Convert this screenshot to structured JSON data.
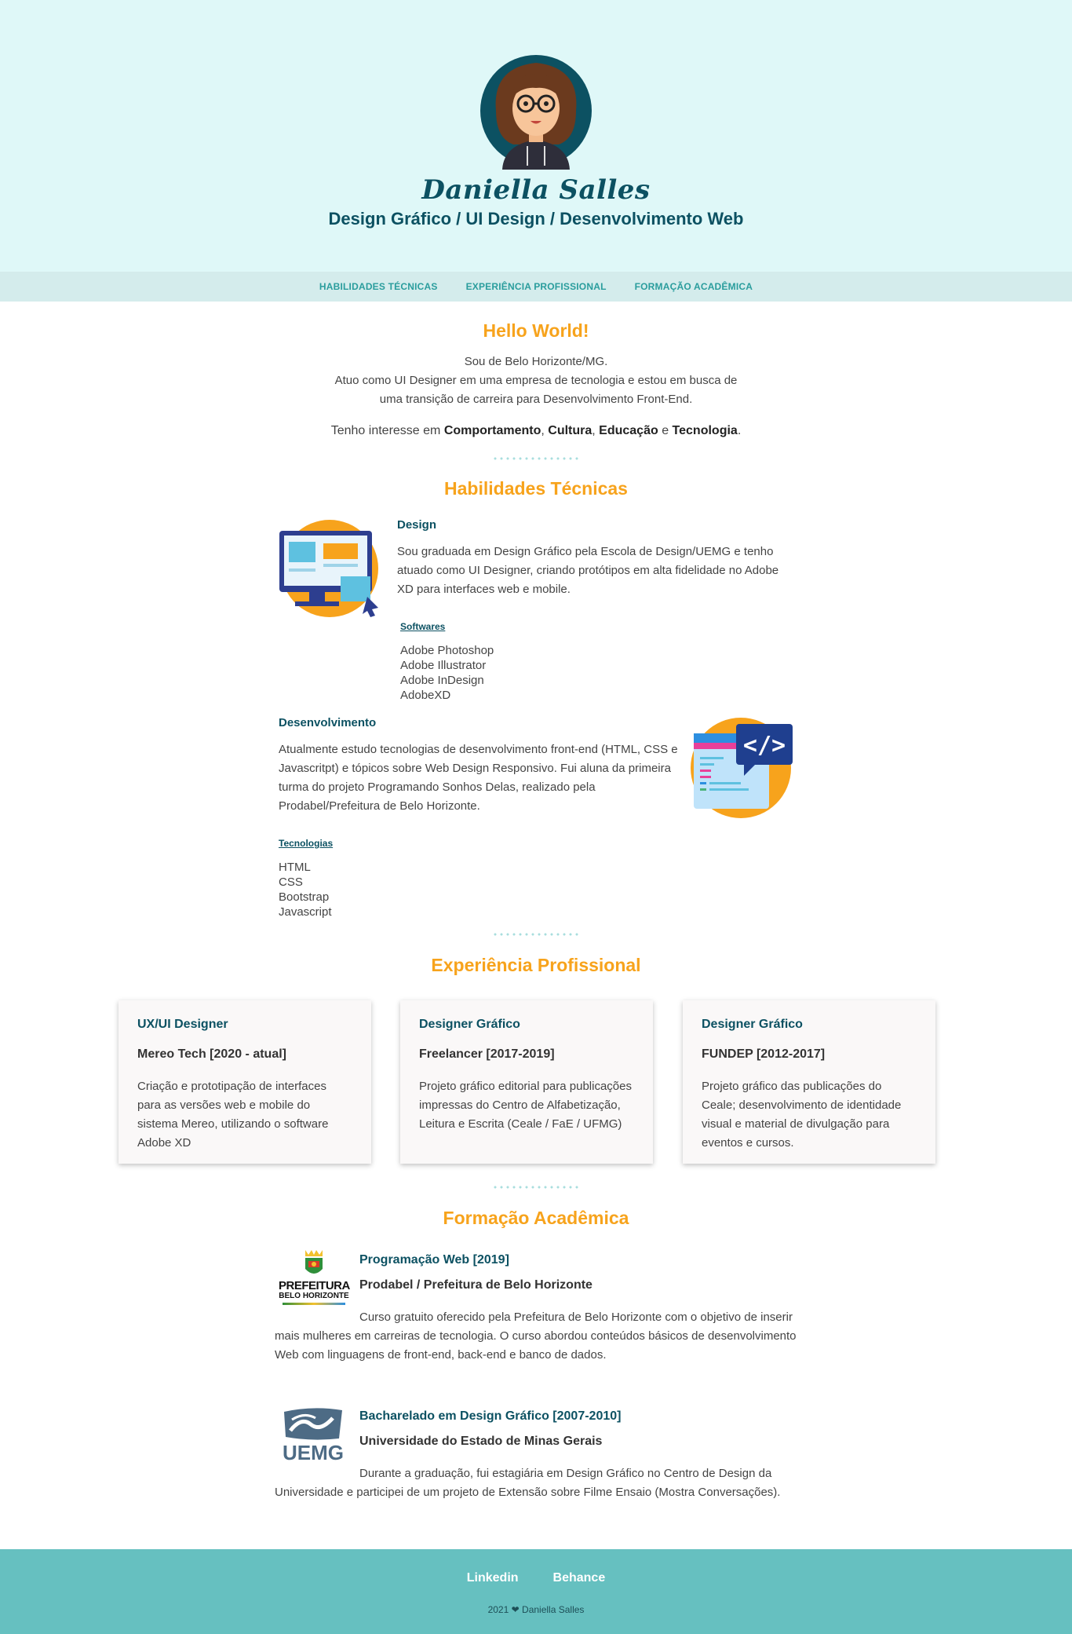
{
  "header": {
    "name": "Daniella Salles",
    "subtitle": "Design Gráfico / UI Design / Desenvolvimento Web"
  },
  "nav": [
    "HABILIDADES TÉCNICAS",
    "EXPERIÊNCIA PROFISSIONAL",
    "FORMAÇÃO ACADÊMICA"
  ],
  "intro": {
    "title": "Hello World!",
    "line1": "Sou de Belo Horizonte/MG.",
    "line2": "Atuo como UI Designer em uma empresa de tecnologia e estou em busca de",
    "line3": "uma transição de carreira para Desenvolvimento Front-End.",
    "interest_prefix": "Tenho interesse em ",
    "interests": [
      "Comportamento",
      "Cultura",
      "Educação",
      "Tecnologia"
    ],
    "sep1": ", ",
    "sep2": ", ",
    "sep3": " e ",
    "end": "."
  },
  "skills": {
    "title": "Habilidades Técnicas",
    "design": {
      "title": "Design",
      "text": "Sou graduada em Design Gráfico pela Escola de Design/UEMG e tenho atuado como UI Designer, criando protótipos em alta fidelidade no Adobe XD para interfaces web e mobile.",
      "list_title": "Softwares",
      "items": [
        "Adobe Photoshop",
        "Adobe Illustrator",
        "Adobe InDesign",
        "AdobeXD"
      ]
    },
    "dev": {
      "title": "Desenvolvimento",
      "text": "Atualmente estudo tecnologias de desenvolvimento front-end (HTML, CSS e Javascritpt) e tópicos sobre Web Design Responsivo. Fui aluna da primeira turma do projeto Programando Sonhos Delas, realizado pela Prodabel/Prefeitura de Belo Horizonte.",
      "list_title": "Tecnologias",
      "items": [
        "HTML",
        "CSS",
        "Bootstrap",
        "Javascript"
      ]
    }
  },
  "experience": {
    "title": "Experiência Profissional",
    "cards": [
      {
        "role": "UX/UI Designer",
        "company": "Mereo Tech [2020 - atual]",
        "desc": "Criação e prototipação de interfaces para as versões web e mobile do sistema Mereo, utilizando o software Adobe XD"
      },
      {
        "role": "Designer Gráfico",
        "company": "Freelancer [2017-2019]",
        "desc": "Projeto gráfico editorial para publicações impressas do Centro de Alfabetização, Leitura e Escrita (Ceale / FaE / UFMG)"
      },
      {
        "role": "Designer Gráfico",
        "company": "FUNDEP [2012-2017]",
        "desc": "Projeto gráfico das publicações do Ceale; desenvolvimento de identidade visual e material de divulgação para eventos e cursos."
      }
    ]
  },
  "education": {
    "title": "Formação Acadêmica",
    "items": [
      {
        "course": "Programação Web [2019]",
        "institution": "Prodabel / Prefeitura de Belo Horizonte",
        "desc": "Curso gratuito oferecido pela Prefeitura de Belo Horizonte com o objetivo de inserir mais mulheres em carreiras de tecnologia. O curso abordou conteúdos básicos de desenvolvimento Web com linguagens de front-end, back-end e banco de dados.",
        "logo_line1": "PREFEITURA",
        "logo_line2": "BELO HORIZONTE"
      },
      {
        "course": "Bacharelado em Design Gráfico [2007-2010]",
        "institution": "Universidade do Estado de Minas Gerais",
        "desc": "Durante a graduação, fui estagiária em Design Gráfico no Centro de Design da Universidade e participei de um projeto de Extensão sobre Filme Ensaio (Mostra Conversações).",
        "logo_text": "UEMG"
      }
    ]
  },
  "footer": {
    "links": [
      "Linkedin",
      "Behance"
    ],
    "year": "2021",
    "heart": "❤",
    "author": "Daniella Salles"
  },
  "colors": {
    "header_bg": "#dff8f8",
    "nav_bg": "#d4ecec",
    "accent_orange": "#f7a31c",
    "primary_teal": "#0c5162",
    "footer_bg": "#66c0c0"
  }
}
